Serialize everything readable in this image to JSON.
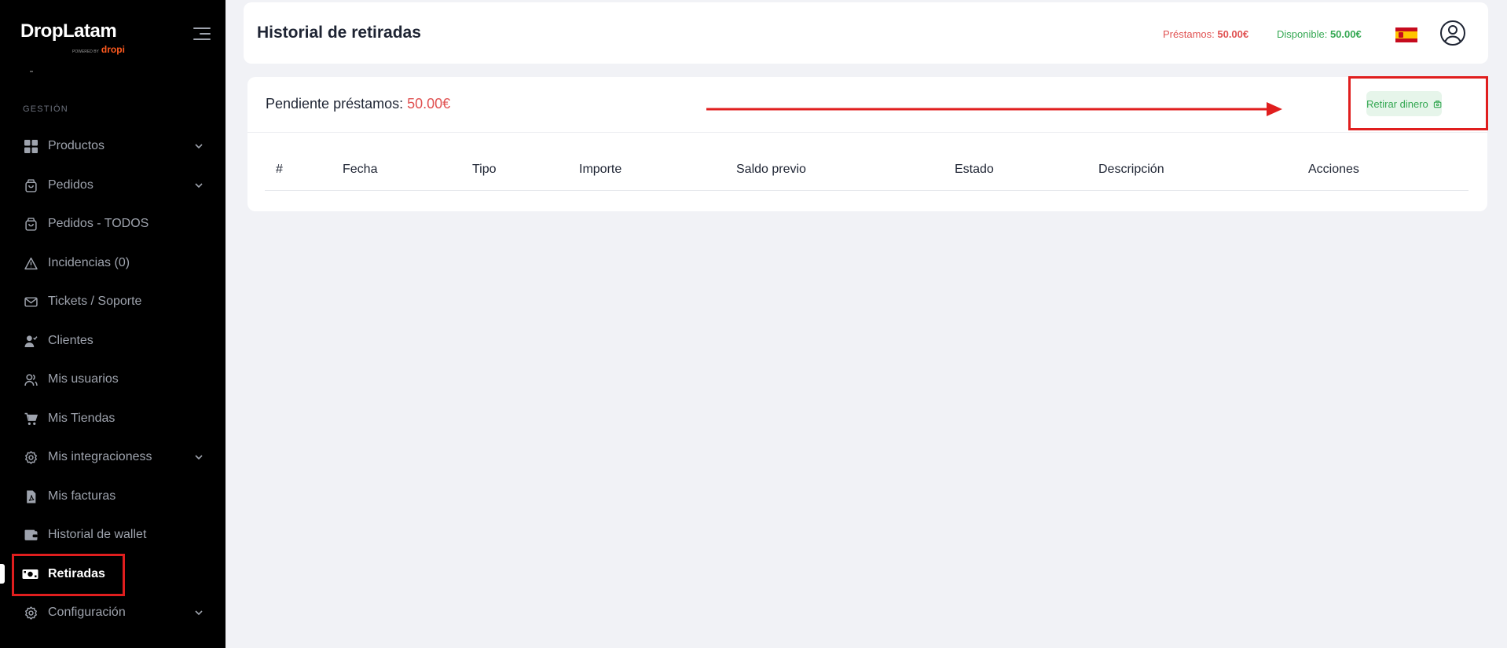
{
  "brand": {
    "name": "DropLatam",
    "powered_by": "POWERED BY",
    "partner": "dropi"
  },
  "sidebar": {
    "section_title": "GESTIÓN",
    "items": [
      {
        "label": "Productos",
        "icon": "grid-icon",
        "chevron": true
      },
      {
        "label": "Pedidos",
        "icon": "bag-icon",
        "chevron": true
      },
      {
        "label": "Pedidos - TODOS",
        "icon": "bag-icon",
        "chevron": false
      },
      {
        "label": "Incidencias (0)",
        "icon": "warning-icon",
        "chevron": false
      },
      {
        "label": "Tickets / Soporte",
        "icon": "mail-icon",
        "chevron": false
      },
      {
        "label": "Clientes",
        "icon": "user-check-icon",
        "chevron": false
      },
      {
        "label": "Mis usuarios",
        "icon": "users-icon",
        "chevron": false
      },
      {
        "label": "Mis Tiendas",
        "icon": "cart-icon",
        "chevron": false
      },
      {
        "label": "Mis integracioness",
        "icon": "settings-icon",
        "chevron": true
      },
      {
        "label": "Mis facturas",
        "icon": "pdf-icon",
        "chevron": false
      },
      {
        "label": "Historial de wallet",
        "icon": "wallet-icon",
        "chevron": false
      },
      {
        "label": "Retiradas",
        "icon": "money-icon",
        "chevron": false,
        "active": true
      },
      {
        "label": "Configuración",
        "icon": "settings-icon",
        "chevron": true
      }
    ]
  },
  "header": {
    "title": "Historial de retiradas",
    "loans_label": "Préstamos: ",
    "loans_value": "50.00€",
    "available_label": "Disponible: ",
    "available_value": "50.00€",
    "language_flag": "es"
  },
  "main": {
    "pending_label": "Pendiente préstamos: ",
    "pending_value": "50.00€",
    "withdraw_button": "Retirar dinero",
    "table": {
      "columns": [
        "#",
        "Fecha",
        "Tipo",
        "Importe",
        "Saldo previo",
        "Estado",
        "Descripción",
        "Acciones"
      ],
      "rows": []
    }
  },
  "colors": {
    "accent_red": "#e05252",
    "accent_green": "#35a853",
    "highlight": "#e01e1e"
  }
}
